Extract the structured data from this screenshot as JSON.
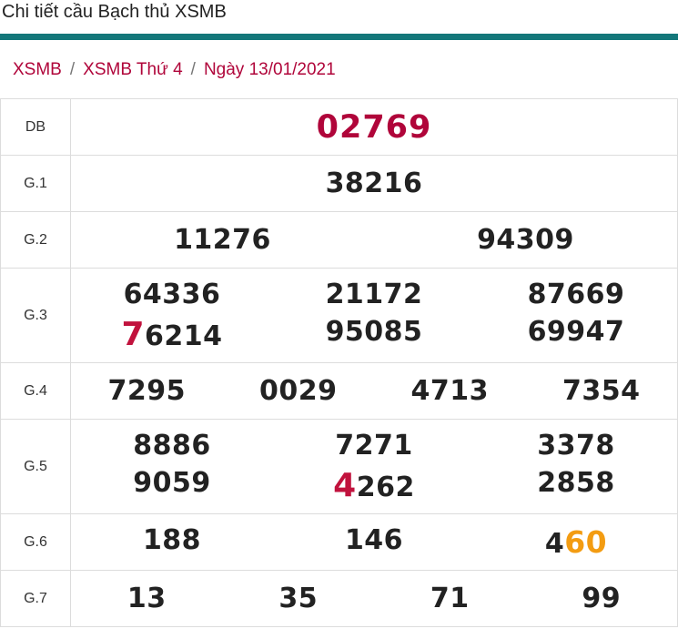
{
  "title": "Chi tiết cầu Bạch thủ XSMB",
  "colors": {
    "accent_bar": "#13777a",
    "link": "#b0053a",
    "highlight_red": "#c1123d",
    "highlight_orange": "#f39c12"
  },
  "breadcrumb": {
    "items": [
      "XSMB",
      "XSMB Thứ 4",
      "Ngày 13/01/2021"
    ],
    "separator": "/"
  },
  "results": {
    "db": {
      "label": "DB",
      "value": "02769"
    },
    "g1": {
      "label": "G.1",
      "values": [
        "38216"
      ]
    },
    "g2": {
      "label": "G.2",
      "values": [
        "11276",
        "94309"
      ]
    },
    "g3": {
      "label": "G.3",
      "values": [
        "64336",
        "21172",
        "87669",
        "76214",
        "95085",
        "69947"
      ],
      "v3_lead": "7",
      "v3_rest": "6214"
    },
    "g4": {
      "label": "G.4",
      "values": [
        "7295",
        "0029",
        "4713",
        "7354"
      ]
    },
    "g5": {
      "label": "G.5",
      "values": [
        "8886",
        "7271",
        "3378",
        "9059",
        "4262",
        "2858"
      ],
      "v4_lead": "4",
      "v4_rest": "262"
    },
    "g6": {
      "label": "G.6",
      "values": [
        "188",
        "146",
        "460"
      ],
      "v2_lead": "4",
      "v2_rest": "60"
    },
    "g7": {
      "label": "G.7",
      "values": [
        "13",
        "35",
        "71",
        "99"
      ]
    }
  }
}
